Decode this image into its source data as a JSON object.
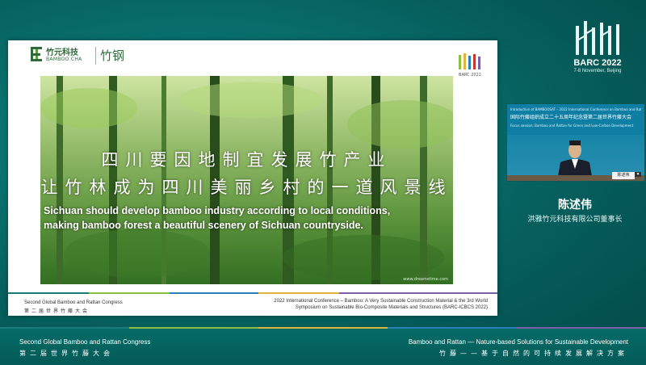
{
  "slide": {
    "company_logo_cn": "竹元科技",
    "company_logo_en": "BAMBOO CHA",
    "company_name": "竹钢",
    "barc_mini_label": "BARC 2022",
    "headline_cn_1": "四川要因地制宜发展竹产业",
    "headline_cn_2": "让竹林成为四川美丽乡村的一道风景线",
    "headline_en_1": "Sichuan should develop bamboo industry according to local conditions,",
    "headline_en_2": "making bamboo forest a beautiful scenery of Sichuan countryside.",
    "watermark": "www.dreamstime.com",
    "footer_left_en": "Second Global Bamboo and Rattan Congress",
    "footer_left_cn": "第二届世界竹藤大会",
    "footer_right_1": "2022 International Conference – Bamboo: A Very Sustainable Construction Material & the 3rd World",
    "footer_right_2": "Symposium on Sustainable Bio-Composite Materials and Structures (BARC-ICBCS 2022)"
  },
  "event": {
    "title": "BARC 2022",
    "date": "7-8 November, Beijing"
  },
  "video": {
    "banner_line_1": "Introduction of BAMBOOSAT – 2022 International Conference on Bamboo and Rattan & Science and Industry Congress",
    "banner_line_2": "国际竹藤组织成立二十五周年纪念暨第二届世界竹藤大会",
    "banner_line_3": "Focus session: Bamboo and Rattan for Green and Low-Carbon Development",
    "nameplate": "陈述伟"
  },
  "speaker": {
    "name": "陈述伟",
    "title": "洪雅竹元科技有限公司董事长"
  },
  "bottom_bar": {
    "left_en": "Second Global Bamboo and Rattan Congress",
    "left_cn": "第二届世界竹藤大会",
    "right_en": "Bamboo and Rattan — Nature-based Solutions for Sustainable Development",
    "right_cn": "竹藤——基于自然的可持续发展解决方案"
  },
  "colors": {
    "background": "#06615f",
    "stripe_colors": [
      "#1a7b7a",
      "#8cbf3f",
      "#e0b43a",
      "#2a7fb8",
      "#7a5fa6"
    ]
  },
  "icons": [
    "bamboo-logo-icon",
    "barc-logo-icon"
  ]
}
